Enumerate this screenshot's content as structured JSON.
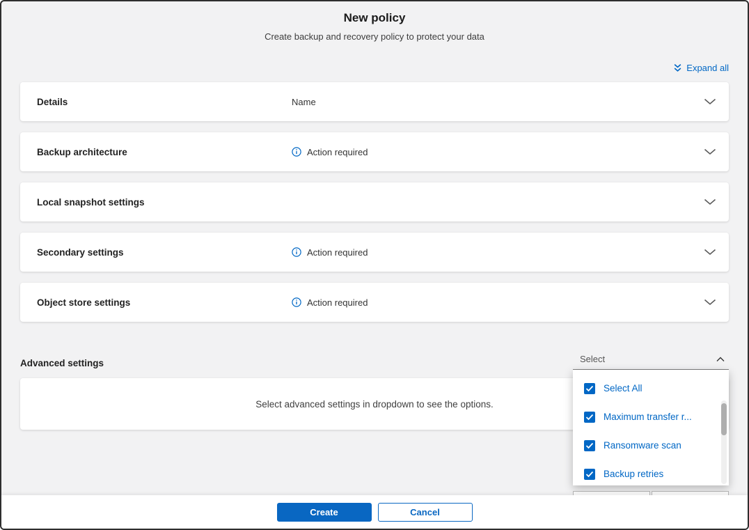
{
  "header": {
    "title": "New policy",
    "subtitle": "Create backup and recovery policy to protect your data",
    "expand_all_label": "Expand all"
  },
  "sections": [
    {
      "label": "Details",
      "middle": "Name",
      "action_required": false
    },
    {
      "label": "Backup architecture",
      "middle": "Action required",
      "action_required": true
    },
    {
      "label": "Local snapshot settings",
      "middle": "",
      "action_required": false
    },
    {
      "label": "Secondary settings",
      "middle": "Action required",
      "action_required": true
    },
    {
      "label": "Object store settings",
      "middle": "Action required",
      "action_required": true
    }
  ],
  "advanced": {
    "label": "Advanced settings",
    "select_label": "Select",
    "placeholder_text": "Select advanced settings in dropdown to see the options.",
    "dropdown_items": [
      {
        "label": "Select All",
        "checked": true
      },
      {
        "label": "Maximum transfer r...",
        "checked": true
      },
      {
        "label": "Ransomware scan",
        "checked": true
      },
      {
        "label": "Backup retries",
        "checked": true
      }
    ]
  },
  "footer": {
    "create_label": "Create",
    "cancel_label": "Cancel"
  },
  "colors": {
    "accent": "#0067C5",
    "button_blue": "#0967C2"
  }
}
